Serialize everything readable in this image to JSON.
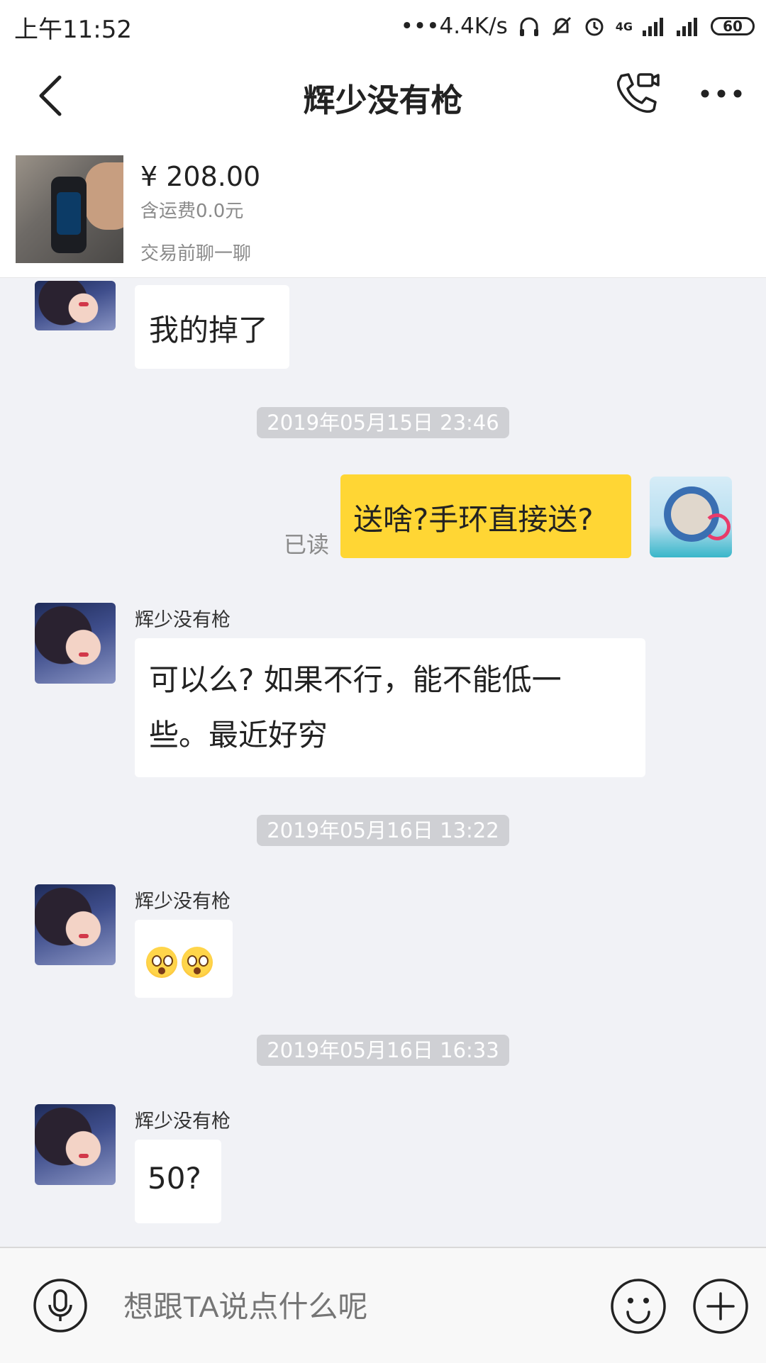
{
  "status_bar": {
    "time": "上午11:52",
    "network_speed": "•••4.4K/s",
    "network_type": "4G",
    "battery": "60"
  },
  "header": {
    "title": "辉少没有枪"
  },
  "product": {
    "price": "¥ 208.00",
    "shipping": "含运费0.0元",
    "chat_before_trade": "交易前聊一聊"
  },
  "messages": {
    "m1_text": "我的掉了",
    "ts1": "2019年05月15日 23:46",
    "m2_read": "已读",
    "m2_text": "送啥?手环直接送?",
    "m3_name": "辉少没有枪",
    "m3_text_line1": "可以么? 如果不行，能不能低一",
    "m3_text_line2": "些。最近好穷",
    "ts2": "2019年05月16日 13:22",
    "m4_name": "辉少没有枪",
    "ts3": "2019年05月16日 16:33",
    "m5_name": "辉少没有枪",
    "m5_text": "50?"
  },
  "input_bar": {
    "placeholder": "想跟TA说点什么呢"
  },
  "icons": {
    "back": "chevron-left-icon",
    "call": "phone-video-icon",
    "more": "more-dots-icon",
    "mic": "microphone-icon",
    "emoji": "smiley-icon",
    "plus": "plus-icon"
  }
}
